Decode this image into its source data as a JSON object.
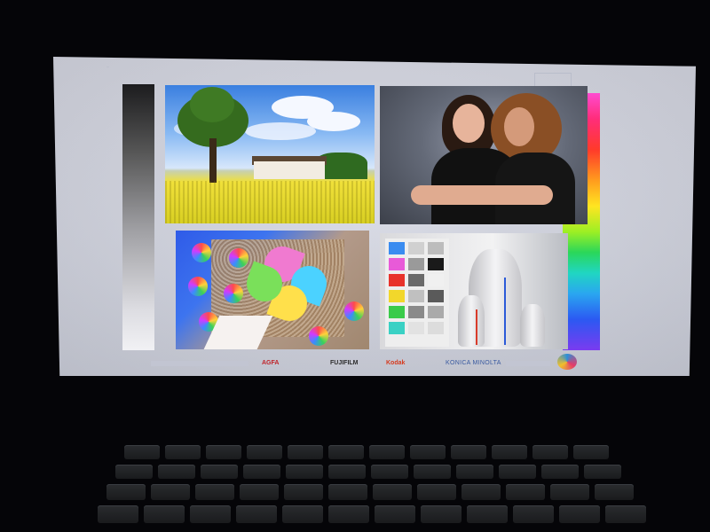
{
  "screen": {
    "header_text": "...",
    "logo_text": "",
    "footer": {
      "brands": [
        "AGFA",
        "FUJIFILM",
        "Kodak",
        "KONICA MINOLTA"
      ]
    }
  },
  "colors": {
    "agfa": "#c0242b",
    "kodak": "#d63b1f",
    "konica": "#3a5aa0"
  },
  "photos": [
    "landscape",
    "portrait",
    "pinwheel",
    "color-chart-vases"
  ],
  "icons": [
    "tree-icon",
    "pinwheel-icon",
    "kodak-k-icon",
    "konica-globe-icon",
    "corner-logo-icon"
  ]
}
